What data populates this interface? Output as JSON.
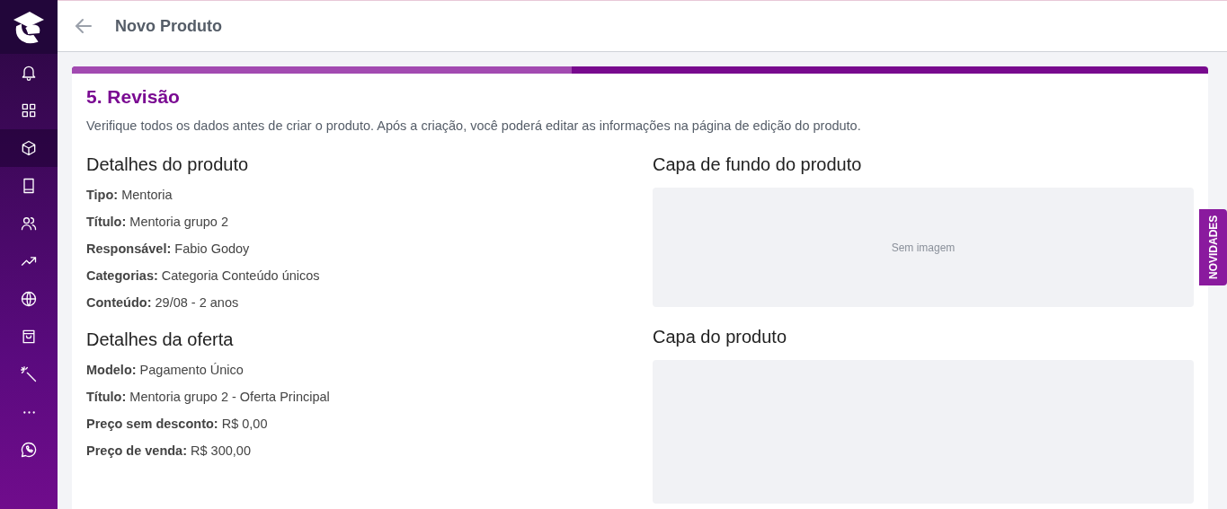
{
  "sidebar": {
    "items": [
      {
        "kind": "bell",
        "selected": false
      },
      {
        "kind": "grid",
        "selected": false
      },
      {
        "kind": "box",
        "selected": true
      },
      {
        "kind": "book",
        "selected": false
      },
      {
        "kind": "users",
        "selected": false
      },
      {
        "kind": "trend",
        "selected": false
      },
      {
        "kind": "globe",
        "selected": false
      },
      {
        "kind": "bag",
        "selected": false
      },
      {
        "kind": "wand",
        "selected": false
      },
      {
        "kind": "more",
        "selected": false
      },
      {
        "kind": "chat",
        "selected": false
      }
    ]
  },
  "header": {
    "title": "Novo Produto"
  },
  "progress": {
    "level": 0.44
  },
  "step": {
    "title": "5. Revisão",
    "description": "Verifique todos os dados antes de criar o produto. Após a criação, você poderá editar as informações na página de edição do produto."
  },
  "product_details": {
    "title": "Detalhes do produto",
    "fields": [
      {
        "label": "Tipo:",
        "value": "Mentoria"
      },
      {
        "label": "Título:",
        "value": "Mentoria grupo 2"
      },
      {
        "label": "Responsável:",
        "value": "Fabio Godoy"
      },
      {
        "label": "Categorias:",
        "value": "Categoria Conteúdo únicos"
      },
      {
        "label": "Conteúdo:",
        "value": "29/08 - 2 anos"
      }
    ]
  },
  "offer_details": {
    "title": "Detalhes da oferta",
    "fields": [
      {
        "label": "Modelo:",
        "value": "Pagamento Único"
      },
      {
        "label": "Título:",
        "value": "Mentoria grupo 2 - Oferta Principal"
      },
      {
        "label": "Preço sem desconto:",
        "value": "R$ 0,00"
      },
      {
        "label": "Preço de venda:",
        "value": "R$ 300,00"
      }
    ]
  },
  "background_cover": {
    "title": "Capa de fundo do produto",
    "empty_text": "Sem imagem"
  },
  "product_cover": {
    "title": "Capa do produto"
  },
  "news_tab": {
    "label": "NOVIDADES"
  }
}
